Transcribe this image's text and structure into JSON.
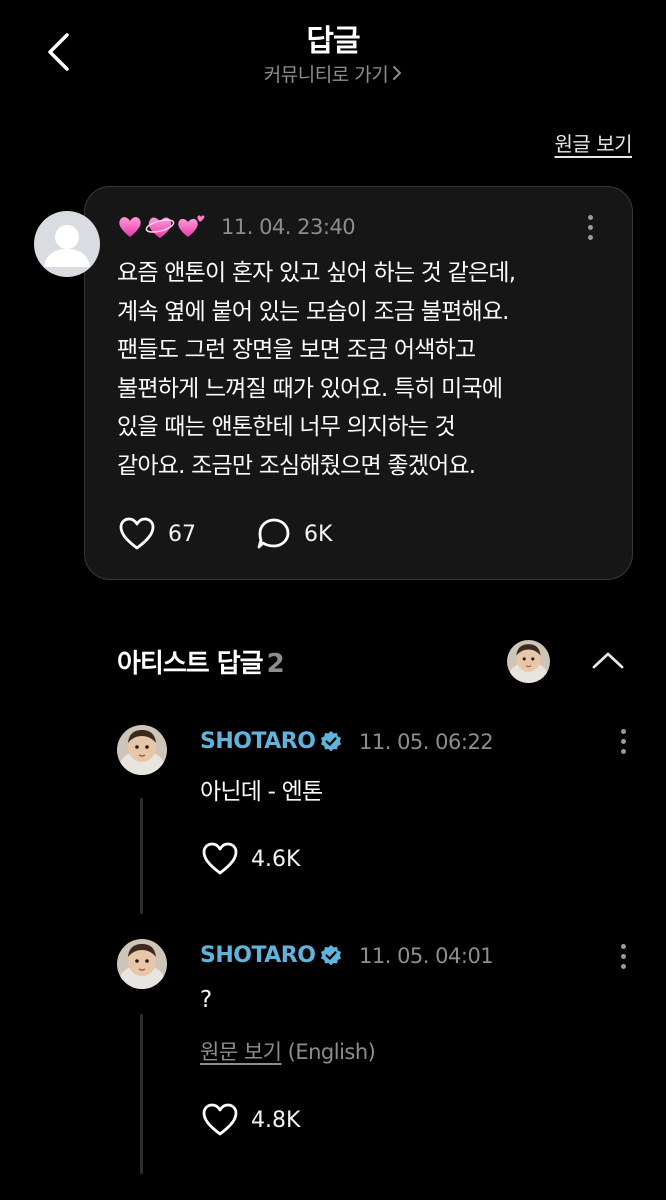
{
  "header": {
    "title": "답글",
    "community_link": "커뮤니티로 가기"
  },
  "view_original": "원글 보기",
  "post": {
    "time": "11. 04. 23:40",
    "lines": [
      "요즘 앤톤이 혼자 있고 싶어 하는 것 같은데,",
      "계속 옆에 붙어 있는 모습이 조금 불편해요.",
      "팬들도 그런 장면을 보면 조금 어색하고",
      "불편하게 느껴질 때가 있어요. 특히 미국에",
      "있을 때는 앤톤한테 너무 의지하는 것",
      "같아요. 조금만 조심해줬으면 좋겠어요."
    ],
    "likes": "67",
    "comments": "6K"
  },
  "artist_section": {
    "title": "아티스트 답글",
    "count": "2"
  },
  "replies": [
    {
      "name": "SHOTARO",
      "time": "11. 05. 06:22",
      "text": "아닌데 - 엔톤",
      "likes": "4.6K"
    },
    {
      "name": "SHOTARO",
      "time": "11. 05. 04:01",
      "text": "?",
      "translate_link": "원문 보기",
      "translate_lang": "(English)",
      "likes": "4.8K"
    }
  ],
  "colors": {
    "background": "#000000",
    "card": "#161616",
    "artist_name": "#5fb4dc",
    "verified_badge": "#5fb4dc",
    "muted_text": "#8d8d8d",
    "hearts": "#ff5fb8"
  }
}
